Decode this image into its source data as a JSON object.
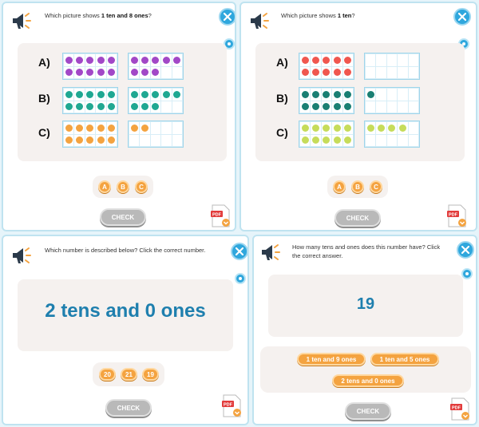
{
  "panel1": {
    "question_pre": "Which picture shows ",
    "question_bold": "1 ten and 8 ones",
    "question_post": "?",
    "options": [
      {
        "label": "A)",
        "color": "#a248c7",
        "frames": [
          10,
          8
        ]
      },
      {
        "label": "B)",
        "color": "#1fa892",
        "frames": [
          10,
          8
        ]
      },
      {
        "label": "C)",
        "color": "#f4a340",
        "frames": [
          10,
          2
        ]
      }
    ],
    "answers": [
      "A",
      "B",
      "C"
    ],
    "check_label": "CHECK",
    "pdf_label": "PDF"
  },
  "panel2": {
    "question_pre": "Which picture shows ",
    "question_bold": "1 ten",
    "question_post": "?",
    "options": [
      {
        "label": "A)",
        "color": "#f0574f",
        "frames": [
          10,
          0
        ]
      },
      {
        "label": "B)",
        "color": "#197f73",
        "frames": [
          10,
          1
        ]
      },
      {
        "label": "C)",
        "color": "#c6dc5a",
        "frames": [
          10,
          4
        ]
      }
    ],
    "answers": [
      "A",
      "B",
      "C"
    ],
    "check_label": "CHECK",
    "pdf_label": "PDF"
  },
  "panel3": {
    "question": "Which number is described below? Click the correct number.",
    "statement": "2 tens and 0 ones",
    "answers": [
      "20",
      "21",
      "19"
    ],
    "check_label": "CHECK",
    "pdf_label": "PDF"
  },
  "panel4": {
    "question": "How many tens and ones does this number have? Click the correct answer.",
    "number": "19",
    "answers": [
      "1 ten and 9 ones",
      "1 ten and 5 ones",
      "2 tens and 0 ones"
    ],
    "check_label": "CHECK",
    "pdf_label": "PDF"
  },
  "colors": {
    "accent": "#2fa7dd",
    "answer": "#f4a340",
    "check": "#b9b9b9",
    "number": "#1e7fae"
  }
}
